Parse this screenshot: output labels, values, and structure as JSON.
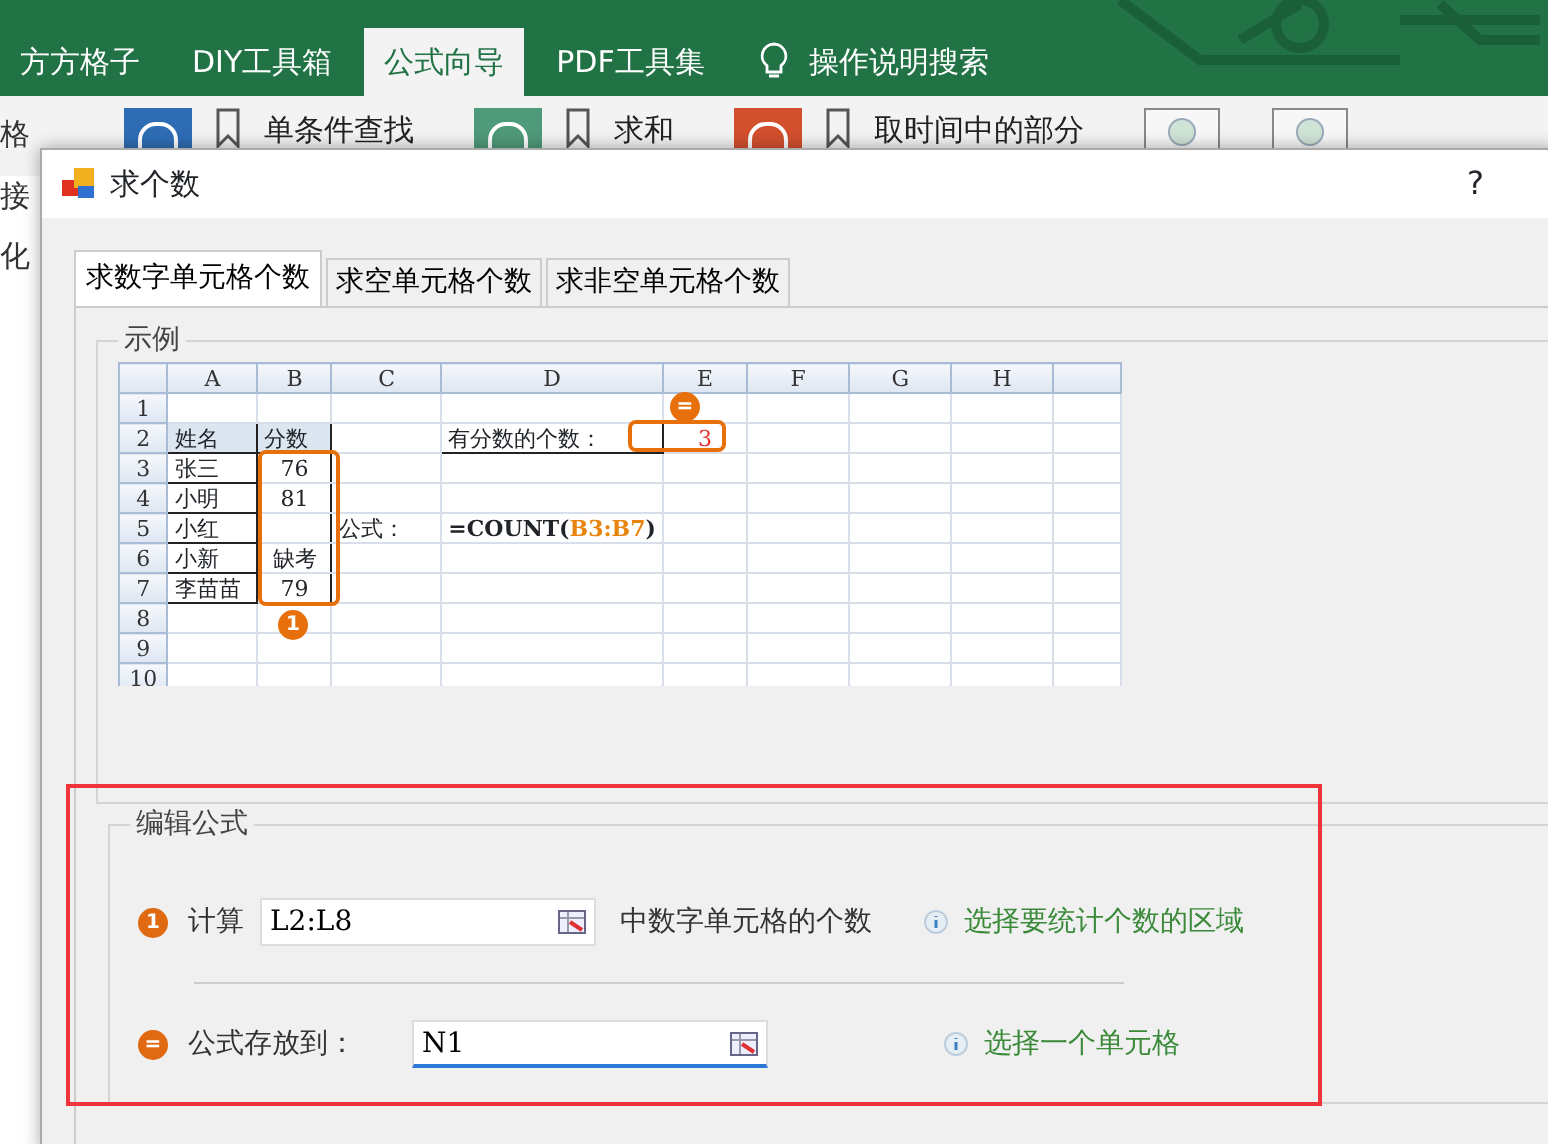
{
  "ribbon_tabs": [
    {
      "label": "方方格子",
      "selected": false
    },
    {
      "label": "DIY工具箱",
      "selected": false
    },
    {
      "label": "公式向导",
      "selected": true
    },
    {
      "label": "PDF工具集",
      "selected": false
    }
  ],
  "tell_me": "操作说明搜索",
  "ribbon_buttons": [
    {
      "label": "单条件查找",
      "color": "#2e6db4"
    },
    {
      "label": "求和",
      "color": "#4f9a7a"
    },
    {
      "label": "取时间中的部分",
      "color": "#d2502e"
    }
  ],
  "side_labels": [
    "格",
    "接",
    "化"
  ],
  "dialog": {
    "title": "求个数",
    "help": "?",
    "tabs": [
      {
        "label": "求数字单元格个数",
        "selected": true
      },
      {
        "label": "求空单元格个数",
        "selected": false
      },
      {
        "label": "求非空单元格个数",
        "selected": false
      }
    ],
    "example": {
      "legend": "示例",
      "columns": [
        "A",
        "B",
        "C",
        "D",
        "E",
        "F",
        "G",
        "H"
      ],
      "rows": [
        {
          "number": "1",
          "cells": []
        },
        {
          "number": "2",
          "cells": [
            {
              "text": "姓名",
              "kind": "header"
            },
            {
              "text": "分数",
              "kind": "header"
            },
            {
              "text": ""
            },
            {
              "text": "有分数的个数：",
              "kind": "label"
            },
            {
              "text": "3",
              "kind": "result"
            }
          ]
        },
        {
          "number": "3",
          "cells": [
            {
              "text": "张三",
              "kind": "data"
            },
            {
              "text": "76",
              "kind": "score"
            }
          ]
        },
        {
          "number": "4",
          "cells": [
            {
              "text": "小明",
              "kind": "data"
            },
            {
              "text": "81",
              "kind": "score"
            }
          ]
        },
        {
          "number": "5",
          "cells": [
            {
              "text": "小红",
              "kind": "data"
            },
            {
              "text": "",
              "kind": "score"
            },
            {
              "text": "公式：",
              "kind": "caption"
            },
            {
              "text": "=COUNT(",
              "ref": "B3:B7",
              "tail": ")",
              "kind": "formula"
            }
          ]
        },
        {
          "number": "6",
          "cells": [
            {
              "text": "小新",
              "kind": "data"
            },
            {
              "text": "缺考",
              "kind": "score"
            }
          ]
        },
        {
          "number": "7",
          "cells": [
            {
              "text": "李苗苗",
              "kind": "data"
            },
            {
              "text": "79",
              "kind": "score"
            }
          ]
        },
        {
          "number": "8",
          "cells": []
        },
        {
          "number": "9",
          "cells": []
        },
        {
          "number": "10",
          "cells": []
        }
      ],
      "callouts": [
        {
          "kind": "range",
          "badge": "1"
        },
        {
          "kind": "result",
          "badge": "="
        }
      ]
    },
    "edit": {
      "legend": "编辑公式",
      "steps": [
        {
          "badge": "1",
          "label": "计算",
          "value": "L2:L8",
          "suffix": "中数字单元格的个数",
          "hint": "选择要统计个数的区域",
          "focused": false
        },
        {
          "badge": "=",
          "label": "公式存放到：",
          "value": "N1",
          "hint": "选择一个单元格",
          "focused": true
        }
      ]
    }
  }
}
